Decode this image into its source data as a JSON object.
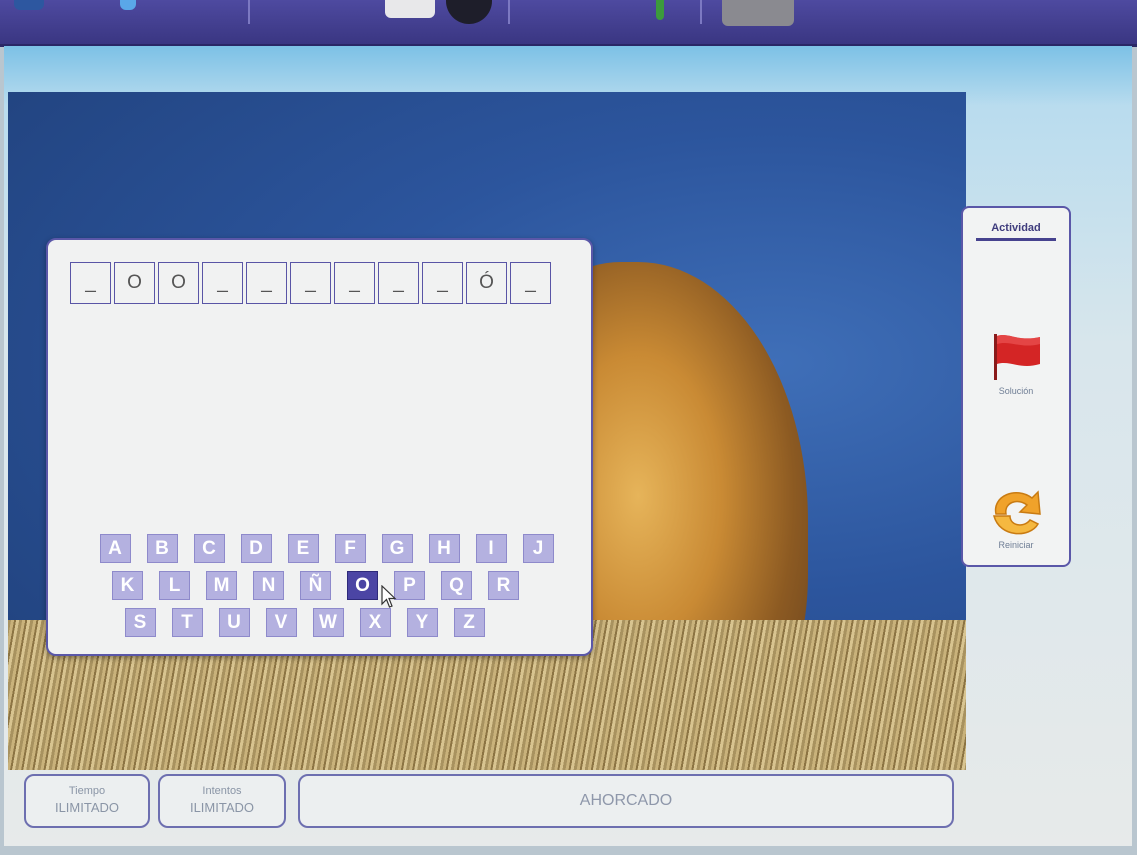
{
  "word_slots": [
    "_",
    "O",
    "O",
    "_",
    "_",
    "_",
    "_",
    "_",
    "_",
    "Ó",
    "_"
  ],
  "keyboard": {
    "row1": [
      "A",
      "B",
      "C",
      "D",
      "E",
      "F",
      "G",
      "H",
      "I",
      "J"
    ],
    "row2": [
      "K",
      "L",
      "M",
      "N",
      "Ñ",
      "O",
      "P",
      "Q",
      "R"
    ],
    "row3": [
      "S",
      "T",
      "U",
      "V",
      "W",
      "X",
      "Y",
      "Z"
    ],
    "selected_key": "O"
  },
  "side_panel": {
    "title": "Actividad",
    "solution_label": "Solución",
    "restart_label": "Reiniciar"
  },
  "status": {
    "time_label": "Tiempo",
    "time_value": "ILIMITADO",
    "attempts_label": "Intentos",
    "attempts_value": "ILIMITADO",
    "game_title": "AHORCADO"
  },
  "colors": {
    "accent": "#5a57a8",
    "key_bg": "#b4b1e0",
    "key_selected": "#4b45a4"
  }
}
